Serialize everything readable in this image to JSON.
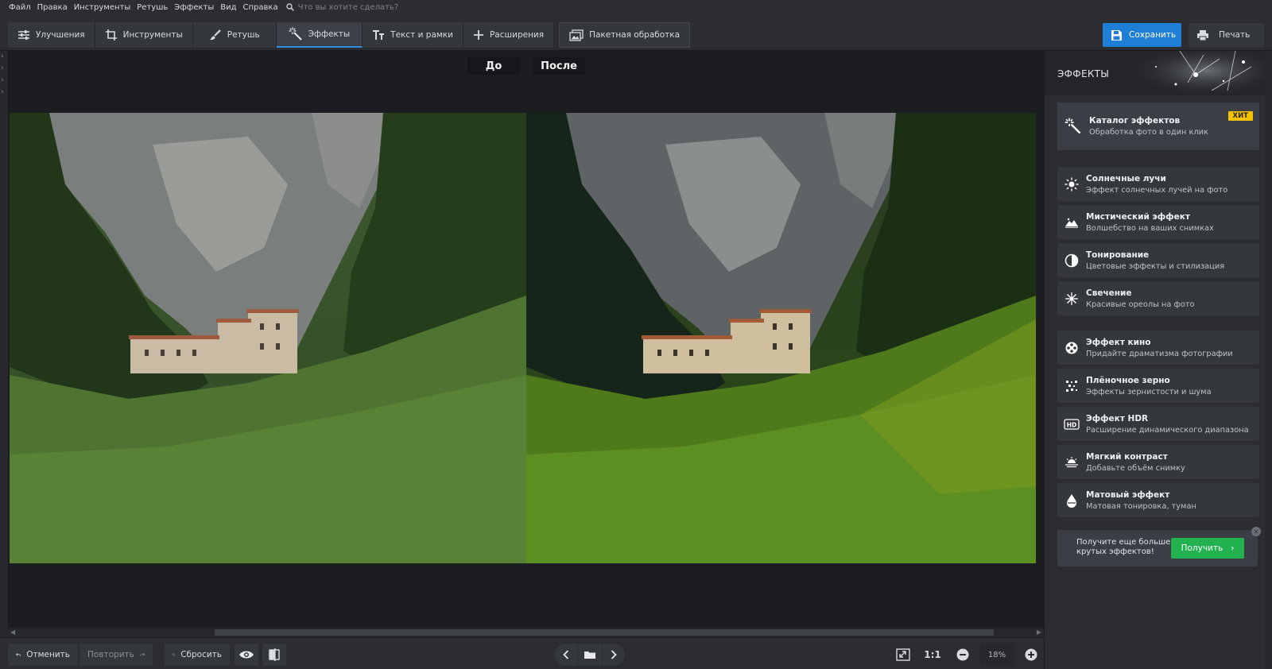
{
  "menu": [
    "Файл",
    "Правка",
    "Инструменты",
    "Ретушь",
    "Эффекты",
    "Вид",
    "Справка"
  ],
  "search": {
    "placeholder": "Что вы хотите сделать?"
  },
  "tabs": [
    {
      "label": "Улучшения",
      "icon": "sliders-icon"
    },
    {
      "label": "Инструменты",
      "icon": "crop-icon"
    },
    {
      "label": "Ретушь",
      "icon": "brush-icon"
    },
    {
      "label": "Эффекты",
      "icon": "magic-wand-icon",
      "active": true
    },
    {
      "label": "Текст и рамки",
      "icon": "text-icon"
    },
    {
      "label": "Расширения",
      "icon": "plus-icon"
    }
  ],
  "batch": {
    "label": "Пакетная обработка",
    "icon": "image-stack-icon"
  },
  "save_label": "Сохранить",
  "print_label": "Печать",
  "compare": {
    "before": "До",
    "after": "После"
  },
  "panel": {
    "title": "ЭФФЕКТЫ",
    "catalog": {
      "title": "Каталог эффектов",
      "subtitle": "Обработка фото в один клик",
      "badge": "ХИТ"
    },
    "effects": [
      {
        "title": "Солнечные лучи",
        "subtitle": "Эффект солнечных лучей на фото",
        "icon": "sun-icon"
      },
      {
        "title": "Мистический эффект",
        "subtitle": "Волшебство на ваших снимках",
        "icon": "landscape-icon"
      },
      {
        "title": "Тонирование",
        "subtitle": "Цветовые эффекты и стилизация",
        "icon": "half-circle-icon"
      },
      {
        "title": "Свечение",
        "subtitle": "Красивые ореолы на фото",
        "icon": "sparkle-icon"
      },
      {
        "title": "Эффект кино",
        "subtitle": "Придайте драматизма фотографии",
        "icon": "film-reel-icon"
      },
      {
        "title": "Плёночное зерно",
        "subtitle": "Эффекты зернистости и шума",
        "icon": "grain-icon"
      },
      {
        "title": "Эффект HDR",
        "subtitle": "Расширение динамического диапазона",
        "icon": "hdr-icon"
      },
      {
        "title": "Мягкий контраст",
        "subtitle": "Добавьте объём снимку",
        "icon": "soft-contrast-icon"
      },
      {
        "title": "Матовый эффект",
        "subtitle": "Матовая тонировка, туман",
        "icon": "drop-icon"
      }
    ],
    "promo": {
      "text": "Получите еще больше крутых эффектов!",
      "button": "Получить"
    }
  },
  "bottom": {
    "undo": "Отменить",
    "redo": "Повторить",
    "reset": "Сбросить",
    "ratio": "1:1",
    "zoom": "18%"
  }
}
